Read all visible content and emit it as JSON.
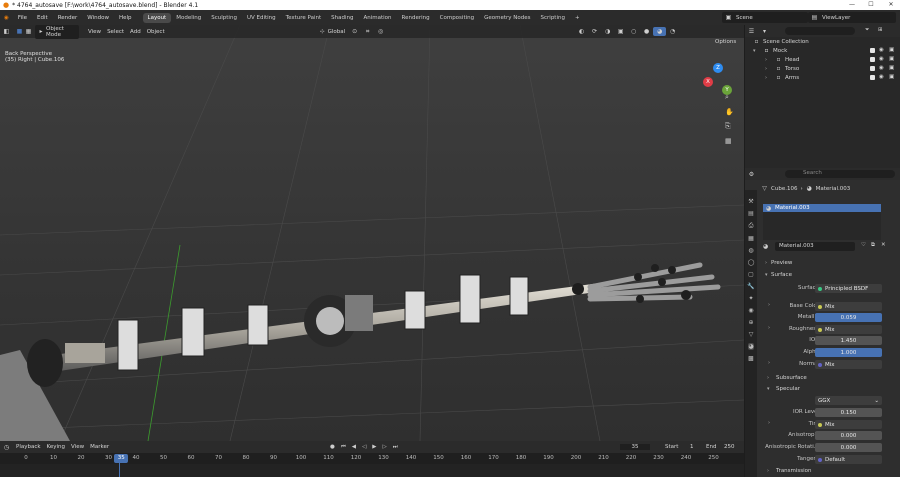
{
  "titlebar": {
    "title": "* 4764_autosave [F:\\work\\4764_autosave.blend] - Blender 4.1",
    "minimize": "—",
    "maximize": "☐",
    "close": "✕"
  },
  "topbar": {
    "menus": [
      "File",
      "Edit",
      "Render",
      "Window",
      "Help"
    ],
    "workspaces": [
      "Layout",
      "Modeling",
      "Sculpting",
      "UV Editing",
      "Texture Paint",
      "Shading",
      "Animation",
      "Rendering",
      "Compositing",
      "Geometry Nodes",
      "Scripting"
    ],
    "active_workspace": "Layout",
    "add_tab": "+",
    "scene": "Scene",
    "view_layer": "ViewLayer"
  },
  "viewport": {
    "mode": "Object Mode",
    "menus": [
      "View",
      "Select",
      "Add",
      "Object"
    ],
    "transform_orientation": "Global",
    "options": "Options",
    "overlay_title": "Back Perspective",
    "overlay_sub": "(35) Right | Cube.106",
    "gizmo": {
      "x": "X",
      "y": "Y",
      "z": "Z"
    }
  },
  "timeline": {
    "menus": [
      "Playback",
      "Keying",
      "View",
      "Marker"
    ],
    "current_frame": "35",
    "start_label": "Start",
    "start": "1",
    "end_label": "End",
    "end": "250",
    "ticks": [
      "0",
      "10",
      "20",
      "30",
      "40",
      "50",
      "60",
      "70",
      "80",
      "90",
      "100",
      "110",
      "120",
      "130",
      "140",
      "150",
      "160",
      "170",
      "180",
      "190",
      "200",
      "210",
      "220",
      "230",
      "240",
      "250"
    ]
  },
  "outliner": {
    "root": "Scene Collection",
    "items": [
      {
        "label": "Mock",
        "level": 0
      },
      {
        "label": "Head",
        "level": 1
      },
      {
        "label": "Torso",
        "level": 1
      },
      {
        "label": "Arms",
        "level": 1
      }
    ]
  },
  "properties": {
    "search_placeholder": "Search",
    "breadcrumb_object": "Cube.106",
    "breadcrumb_material": "Material.003",
    "slot": "Material.003",
    "material_name": "Material.003",
    "sections": {
      "preview": "Preview",
      "surface": "Surface",
      "subsurface": "Subsurface",
      "specular": "Specular",
      "transmission": "Transmission"
    },
    "fields": [
      {
        "label": "Surface",
        "value": "Principled BSDF",
        "type": "shader"
      },
      {
        "label": "Base Color",
        "value": "Mix",
        "type": "link"
      },
      {
        "label": "Metallic",
        "value": "0.059",
        "type": "number"
      },
      {
        "label": "Roughness",
        "value": "Mix",
        "type": "link"
      },
      {
        "label": "IOR",
        "value": "1.450",
        "type": "number"
      },
      {
        "label": "Alpha",
        "value": "1.000",
        "type": "number"
      },
      {
        "label": "Normal",
        "value": "Mix",
        "type": "link"
      }
    ],
    "specular_fields": [
      {
        "label": "",
        "value": "GGX",
        "type": "dropdown"
      },
      {
        "label": "IOR Level",
        "value": "0.150",
        "type": "number"
      },
      {
        "label": "Tint",
        "value": "Mix",
        "type": "link"
      },
      {
        "label": "Anisotropic",
        "value": "0.000",
        "type": "number"
      },
      {
        "label": "Anisotropic Rotati...",
        "value": "0.000",
        "type": "number"
      },
      {
        "label": "Tangent",
        "value": "Default",
        "type": "link"
      }
    ]
  },
  "colors": {
    "accent": "#4772b3",
    "title_bg": "#ffffff",
    "header": "#2b2b2b",
    "panel": "#2e2e2e",
    "field": "#545454",
    "link_dot": "#c8c853",
    "shader_dot": "#39c884"
  }
}
